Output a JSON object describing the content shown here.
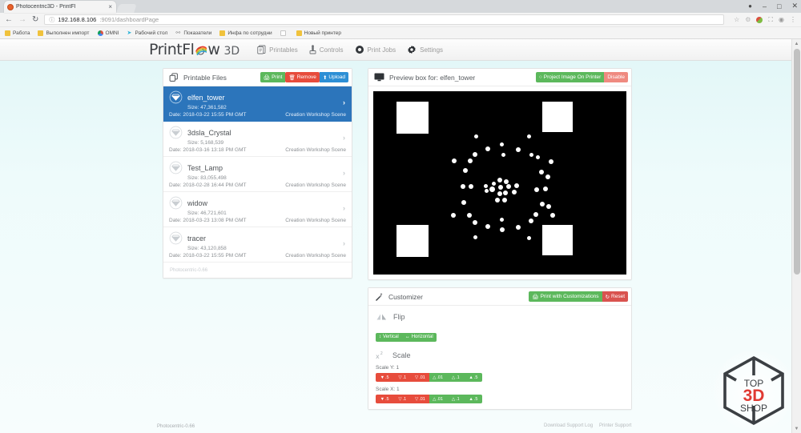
{
  "browser": {
    "tab": {
      "title": "Photocentric3D - PrintFl",
      "close_label": "×"
    },
    "new_tab_label": "",
    "window_controls": {
      "profile": "●",
      "minimize": "–",
      "maximize": "□",
      "close": "✕"
    },
    "nav": {
      "back": "←",
      "forward": "→",
      "reload": "↻"
    },
    "omnibox": {
      "info_icon": "ⓘ",
      "host": "192.168.8.106",
      "rest": ":9091/dashboardPage",
      "star": "☆"
    },
    "toolbar_icons": [
      "star-icon",
      "extension-icon",
      "profile-orb-icon",
      "cast-icon",
      "comment-icon",
      "menu-icon"
    ],
    "menu_glyph": "⋮",
    "bookmarks": [
      {
        "label": "Работа",
        "icon": "folder"
      },
      {
        "label": "Выполнен импорт",
        "icon": "folder"
      },
      {
        "label": "OMNI",
        "icon": "chrome"
      },
      {
        "label": "Рабочий стол",
        "icon": "telegram"
      },
      {
        "label": "Показатели",
        "icon": "molecule"
      },
      {
        "label": "Инфа по сотрудни",
        "icon": "folder"
      },
      {
        "label": "",
        "icon": "doc"
      },
      {
        "label": "Новый принтер",
        "icon": "folder"
      }
    ]
  },
  "app": {
    "logo": {
      "text_a": "PrintFl",
      "text_b": "w",
      "suffix": "3D"
    },
    "nav": [
      {
        "label": "Printables",
        "icon": "printables-icon"
      },
      {
        "label": "Controls",
        "icon": "controls-icon"
      },
      {
        "label": "Print Jobs",
        "icon": "print-jobs-icon"
      },
      {
        "label": "Settings",
        "icon": "settings-gear-icon"
      }
    ]
  },
  "printable_files": {
    "title": "Printable Files",
    "buttons": {
      "print": "Print",
      "remove": "Remove",
      "upload": "Upload"
    },
    "footer": "Photocentric-0.66",
    "items": [
      {
        "name": "elfen_tower",
        "size": "Size: 47,361,582",
        "date": "Date: 2018-03-22 15:55 PM GMT",
        "type": "Creation Workshop Scene",
        "selected": true
      },
      {
        "name": "3dsla_Crystal",
        "size": "Size: 5,168,539",
        "date": "Date: 2018-03-16 13:18 PM GMT",
        "type": "Creation Workshop Scene",
        "selected": false
      },
      {
        "name": "Test_Lamp",
        "size": "Size: 83,055,498",
        "date": "Date: 2018-02-28 16:44 PM GMT",
        "type": "Creation Workshop Scene",
        "selected": false
      },
      {
        "name": "widow",
        "size": "Size: 46,721,601",
        "date": "Date: 2018-03-23 13:08 PM GMT",
        "type": "Creation Workshop Scene",
        "selected": false
      },
      {
        "name": "tracer",
        "size": "Size: 43,120,858",
        "date": "Date: 2018-03-22 15:55 PM GMT",
        "type": "Creation Workshop Scene",
        "selected": false
      }
    ]
  },
  "preview": {
    "title": "Preview box for: elfen_tower",
    "buttons": {
      "project": "Project Image On Printer",
      "disable": "Disable"
    }
  },
  "customizer": {
    "title": "Customizer",
    "buttons": {
      "print_custom": "Print with Customizations",
      "reset": "Reset"
    },
    "flip": {
      "title": "Flip",
      "vertical": "Vertical",
      "horizontal": "Horizontal"
    },
    "scale": {
      "title": "Scale",
      "label_y": "Scale Y: 1",
      "label_x": "Scale X: 1",
      "steps_down": [
        ".5",
        ".1",
        ".01"
      ],
      "steps_up": [
        ".01",
        ".1",
        ".5"
      ]
    }
  },
  "footer": {
    "status": "Photocentric-0.66",
    "links": [
      "Download Support Log",
      "Printer Support"
    ]
  },
  "watermark": {
    "top": "TOP",
    "mid": "3D",
    "bottom": "SHOP"
  },
  "colors": {
    "accent_blue": "#2c75bb",
    "green": "#5cb85c",
    "red": "#e74c3c",
    "upload_blue": "#2d8fd5",
    "watermark_red": "#e03a33"
  }
}
